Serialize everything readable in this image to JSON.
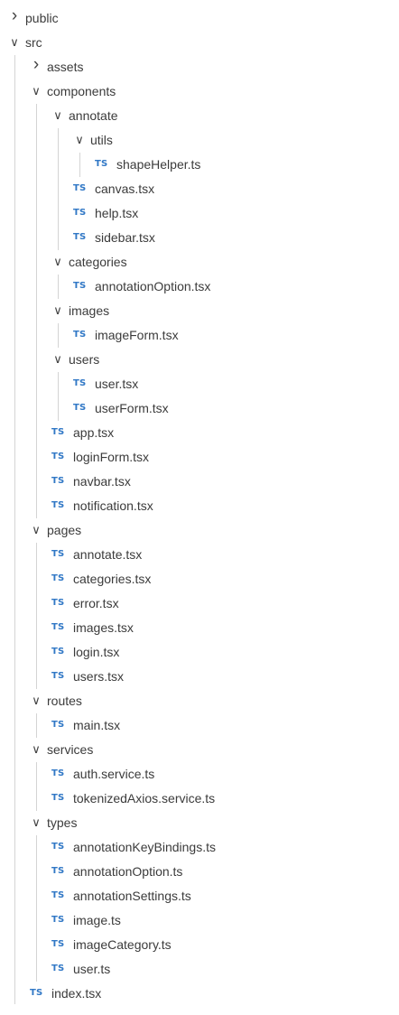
{
  "explorer": {
    "items": [
      {
        "label": "public",
        "kind": "folder",
        "expanded": false,
        "depth": 0
      },
      {
        "label": "src",
        "kind": "folder",
        "expanded": true,
        "depth": 0
      },
      {
        "label": "assets",
        "kind": "folder",
        "expanded": false,
        "depth": 1
      },
      {
        "label": "components",
        "kind": "folder",
        "expanded": true,
        "depth": 1
      },
      {
        "label": "annotate",
        "kind": "folder",
        "expanded": true,
        "depth": 2
      },
      {
        "label": "utils",
        "kind": "folder",
        "expanded": true,
        "depth": 3
      },
      {
        "label": "shapeHelper.ts",
        "kind": "file",
        "icon": "TS",
        "depth": 4
      },
      {
        "label": "canvas.tsx",
        "kind": "file",
        "icon": "TS",
        "depth": 3
      },
      {
        "label": "help.tsx",
        "kind": "file",
        "icon": "TS",
        "depth": 3
      },
      {
        "label": "sidebar.tsx",
        "kind": "file",
        "icon": "TS",
        "depth": 3
      },
      {
        "label": "categories",
        "kind": "folder",
        "expanded": true,
        "depth": 2
      },
      {
        "label": "annotationOption.tsx",
        "kind": "file",
        "icon": "TS",
        "depth": 3
      },
      {
        "label": "images",
        "kind": "folder",
        "expanded": true,
        "depth": 2
      },
      {
        "label": "imageForm.tsx",
        "kind": "file",
        "icon": "TS",
        "depth": 3
      },
      {
        "label": "users",
        "kind": "folder",
        "expanded": true,
        "depth": 2
      },
      {
        "label": "user.tsx",
        "kind": "file",
        "icon": "TS",
        "depth": 3
      },
      {
        "label": "userForm.tsx",
        "kind": "file",
        "icon": "TS",
        "depth": 3
      },
      {
        "label": "app.tsx",
        "kind": "file",
        "icon": "TS",
        "depth": 2
      },
      {
        "label": "loginForm.tsx",
        "kind": "file",
        "icon": "TS",
        "depth": 2
      },
      {
        "label": "navbar.tsx",
        "kind": "file",
        "icon": "TS",
        "depth": 2
      },
      {
        "label": "notification.tsx",
        "kind": "file",
        "icon": "TS",
        "depth": 2
      },
      {
        "label": "pages",
        "kind": "folder",
        "expanded": true,
        "depth": 1
      },
      {
        "label": "annotate.tsx",
        "kind": "file",
        "icon": "TS",
        "depth": 2
      },
      {
        "label": "categories.tsx",
        "kind": "file",
        "icon": "TS",
        "depth": 2
      },
      {
        "label": "error.tsx",
        "kind": "file",
        "icon": "TS",
        "depth": 2
      },
      {
        "label": "images.tsx",
        "kind": "file",
        "icon": "TS",
        "depth": 2
      },
      {
        "label": "login.tsx",
        "kind": "file",
        "icon": "TS",
        "depth": 2
      },
      {
        "label": "users.tsx",
        "kind": "file",
        "icon": "TS",
        "depth": 2
      },
      {
        "label": "routes",
        "kind": "folder",
        "expanded": true,
        "depth": 1
      },
      {
        "label": "main.tsx",
        "kind": "file",
        "icon": "TS",
        "depth": 2
      },
      {
        "label": "services",
        "kind": "folder",
        "expanded": true,
        "depth": 1
      },
      {
        "label": "auth.service.ts",
        "kind": "file",
        "icon": "TS",
        "depth": 2
      },
      {
        "label": "tokenizedAxios.service.ts",
        "kind": "file",
        "icon": "TS",
        "depth": 2
      },
      {
        "label": "types",
        "kind": "folder",
        "expanded": true,
        "depth": 1
      },
      {
        "label": "annotationKeyBindings.ts",
        "kind": "file",
        "icon": "TS",
        "depth": 2
      },
      {
        "label": "annotationOption.ts",
        "kind": "file",
        "icon": "TS",
        "depth": 2
      },
      {
        "label": "annotationSettings.ts",
        "kind": "file",
        "icon": "TS",
        "depth": 2
      },
      {
        "label": "image.ts",
        "kind": "file",
        "icon": "TS",
        "depth": 2
      },
      {
        "label": "imageCategory.ts",
        "kind": "file",
        "icon": "TS",
        "depth": 2
      },
      {
        "label": "user.ts",
        "kind": "file",
        "icon": "TS",
        "depth": 2
      },
      {
        "label": "index.tsx",
        "kind": "file",
        "icon": "TS",
        "depth": 1
      }
    ]
  },
  "icons": {
    "collapsed": "chevron-right-icon",
    "expanded": "chevron-down-icon",
    "file": "typescript-file-icon"
  },
  "colors": {
    "ts_icon": "#3178c6",
    "guide": "#d4d4d4",
    "text": "#3b3b3b"
  }
}
